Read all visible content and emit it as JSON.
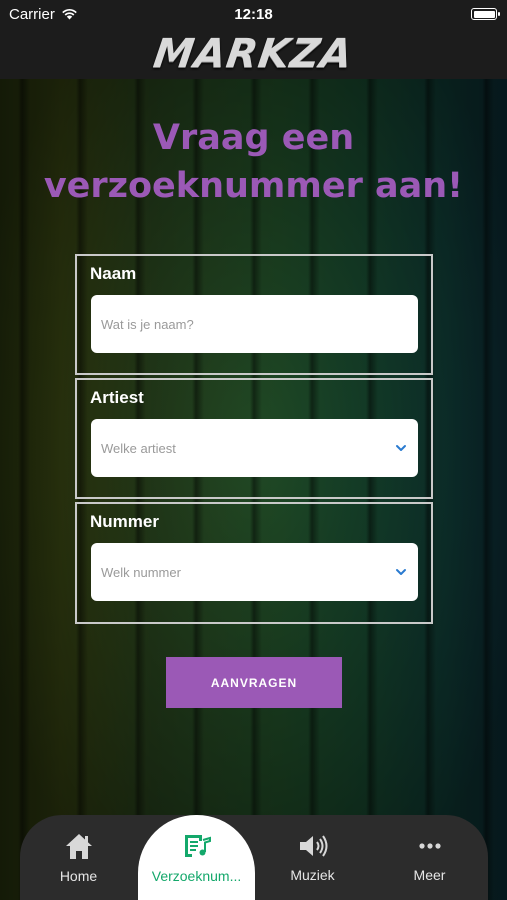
{
  "status_bar": {
    "carrier": "Carrier",
    "time": "12:18"
  },
  "header": {
    "logo": "MARKZA"
  },
  "page": {
    "title": "Vraag een verzoeknummer aan!"
  },
  "form": {
    "name": {
      "label": "Naam",
      "placeholder": "Wat is je naam?"
    },
    "artist": {
      "label": "Artiest",
      "placeholder": "Welke artiest"
    },
    "track": {
      "label": "Nummer",
      "placeholder": "Welk nummer"
    },
    "submit_label": "AANVRAGEN"
  },
  "tabs": [
    {
      "label": "Home",
      "icon": "home-icon"
    },
    {
      "label": "Verzoeknum...",
      "icon": "music-note-list-icon",
      "active": true
    },
    {
      "label": "Muziek",
      "icon": "speaker-icon"
    },
    {
      "label": "Meer",
      "icon": "more-dots-icon"
    }
  ],
  "colors": {
    "accent": "#9b59b6",
    "active_tab": "#14a86b",
    "chevron": "#2a7bd0"
  }
}
